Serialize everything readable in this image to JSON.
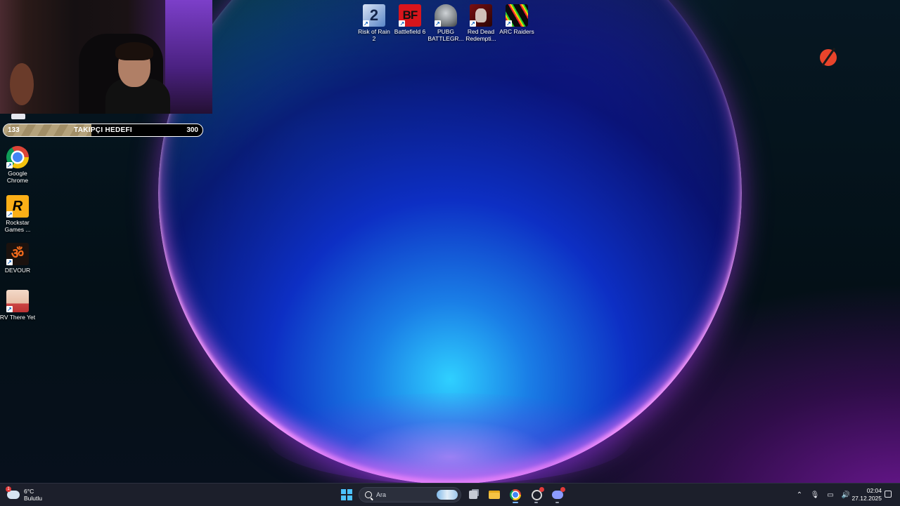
{
  "stream_overlay": {
    "follower_goal": {
      "current": "133",
      "title": "TAKIPÇI HEDEFI",
      "target": "300",
      "progress_fraction": 0.443
    }
  },
  "desktop": {
    "left_icons": [
      {
        "label": "Google\nChrome",
        "icon": "chrome-icon"
      },
      {
        "label": "Rockstar\nGames ...",
        "icon": "rockstar-icon",
        "glyph": "R"
      },
      {
        "label": "DEVOUR",
        "icon": "devour-icon",
        "glyph": "ॐ"
      },
      {
        "label": "RV There Yet",
        "icon": "rv-there-yet-icon"
      }
    ],
    "top_icons": [
      {
        "label": "Risk of Rain 2",
        "icon": "risk-of-rain-2-icon",
        "glyph": "2"
      },
      {
        "label": "Battlefield 6",
        "icon": "battlefield-6-icon",
        "glyph": "BF"
      },
      {
        "label": "PUBG\nBATTLEGR...",
        "icon": "pubg-icon"
      },
      {
        "label": "Red Dead\nRedempti...",
        "icon": "red-dead-redemption-icon"
      },
      {
        "label": "ARC Raiders",
        "icon": "arc-raiders-icon"
      }
    ],
    "shortcut_glyph": "↗"
  },
  "taskbar": {
    "weather": {
      "temp": "6°C",
      "condition": "Bulutlu",
      "badge": "1"
    },
    "search_placeholder": "Ara",
    "apps": [
      "start-icon",
      "search",
      "task-view-icon",
      "file-explorer-icon",
      "chrome-icon",
      "obs-icon",
      "discord-icon"
    ],
    "tray_glyphs": {
      "chevron": "⌃",
      "mic": "🎙",
      "network": "▭",
      "volume": "🔊"
    },
    "clock": {
      "time": "02:04",
      "date": "27.12.2025"
    }
  },
  "colors": {
    "taskbar_bg": "#1c1f2b",
    "accent": "#4cc2ff",
    "goal_fill": "#c9b58a"
  }
}
